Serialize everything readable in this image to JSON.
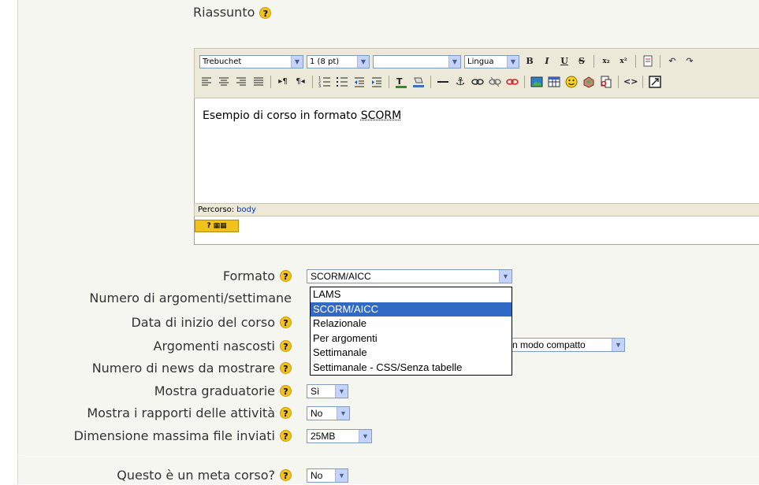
{
  "section": {
    "title": "Riassunto"
  },
  "editor": {
    "font_family": "Trebuchet",
    "font_size": "1 (8 pt)",
    "style_value": "",
    "language": "Lingua",
    "content_prefix": "Esempio di corso in formato ",
    "content_word": "SCORM",
    "path_label": "Percorso:",
    "path_value": "body"
  },
  "form": {
    "format_label": "Formato",
    "format_value": "SCORM/AICC",
    "num_topics_label": "Numero di argomenti/settimane",
    "start_date_label": "Data di inizio del corso",
    "hidden_sections_label": "Argomenti nascosti",
    "hidden_sections_value_partial": "n modo compatto",
    "news_items_label": "Numero di news da mostrare",
    "show_grades_label": "Mostra graduatorie",
    "show_grades_value": "Sì",
    "show_reports_label": "Mostra i rapporti delle attività",
    "show_reports_value": "No",
    "max_upload_label": "Dimensione massima file inviati",
    "max_upload_value": "25MB",
    "meta_course_label": "Questo è un meta corso?",
    "meta_course_value": "No"
  },
  "format_options": [
    "LAMS",
    "SCORM/AICC",
    "Relazionale",
    "Per argomenti",
    "Settimanale",
    "Settimanale - CSS/Senza tabelle"
  ],
  "colors": {
    "background": "#f6f6f0",
    "toolbar": "#ece9d8",
    "selection": "#316ac5",
    "help_icon": "#f2c21a",
    "link": "#0033cc"
  }
}
